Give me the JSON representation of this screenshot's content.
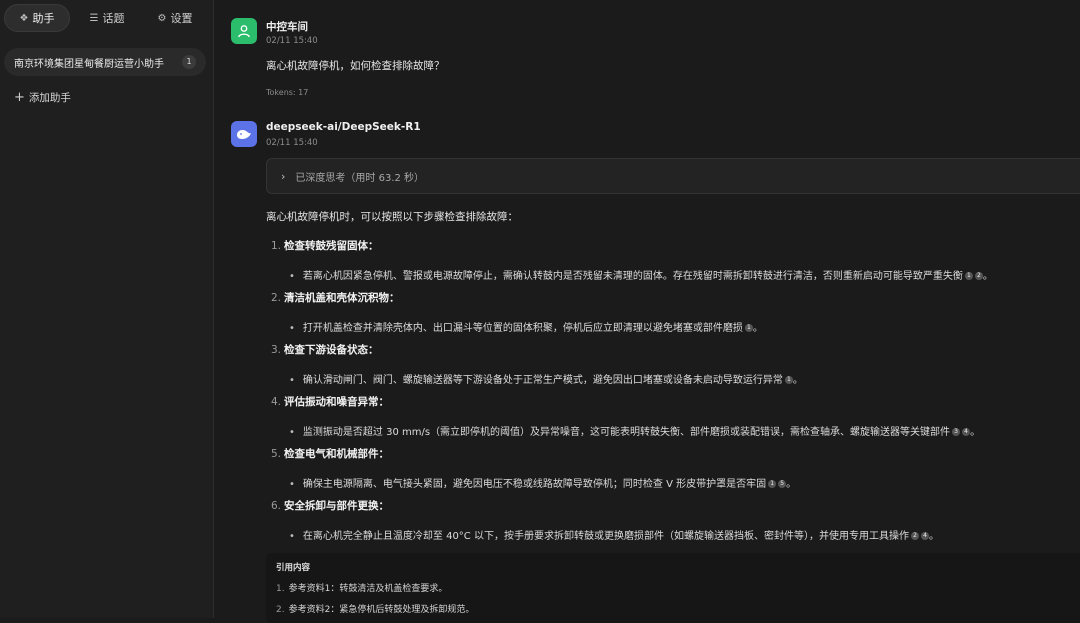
{
  "sidebar": {
    "tabs": [
      {
        "icon": "sparkle-icon",
        "glyph": "❖",
        "label": "助手"
      },
      {
        "icon": "list-icon",
        "glyph": "☰",
        "label": "话题"
      },
      {
        "icon": "gear-icon",
        "glyph": "⚙",
        "label": "设置"
      }
    ],
    "assistant": {
      "name": "南京环境集团星甸餐厨运营小助手",
      "count": "1"
    },
    "add_label": "添加助手"
  },
  "user_message": {
    "author": "中控车间",
    "time": "02/11 15:40",
    "text": "离心机故障停机，如何检查排除故障？",
    "tokens": "Tokens: 17"
  },
  "bot_message": {
    "author": "deepseek-ai/DeepSeek-R1",
    "time": "02/11 15:40",
    "thinking_label": "已深度思考（用时 63.2 秒）",
    "intro": "离心机故障停机时，可以按照以下步骤检查排除故障：",
    "steps": [
      {
        "num": "1.",
        "title": "检查转鼓残留固体：",
        "body": "若离心机因紧急停机、警报或电源故障停止，需确认转鼓内是否残留未清理的固体。存在残留时需拆卸转鼓进行清洁，否则重新启动可能导致严重失衡",
        "cites": [
          "1",
          "2"
        ]
      },
      {
        "num": "2.",
        "title": "清洁机盖和壳体沉积物：",
        "body": "打开机盖检查并清除壳体内、出口漏斗等位置的固体积聚，停机后应立即清理以避免堵塞或部件磨损",
        "cites": [
          "1"
        ]
      },
      {
        "num": "3.",
        "title": "检查下游设备状态：",
        "body": "确认滑动闸门、阀门、螺旋输送器等下游设备处于正常生产模式，避免因出口堵塞或设备未启动导致运行异常",
        "cites": [
          "1"
        ]
      },
      {
        "num": "4.",
        "title": "评估振动和噪音异常：",
        "body": "监测振动是否超过 30 mm/s（需立即停机的阈值）及异常噪音，这可能表明转鼓失衡、部件磨损或装配错误，需检查轴承、螺旋输送器等关键部件",
        "cites": [
          "3",
          "4"
        ]
      },
      {
        "num": "5.",
        "title": "检查电气和机械部件：",
        "body": "确保主电源隔离、电气接头紧固，避免因电压不稳或线路故障导致停机；同时检查 V 形皮带护罩是否牢固",
        "cites": [
          "1",
          "5"
        ]
      },
      {
        "num": "6.",
        "title": "安全拆卸与部件更换：",
        "body": "在离心机完全静止且温度冷却至 40°C 以下，按手册要求拆卸转鼓或更换磨损部件（如螺旋输送器挡板、密封件等），并使用专用工具操作",
        "cites": [
          "2",
          "4"
        ]
      }
    ],
    "references": {
      "title": "引用内容",
      "items": [
        {
          "num": "1.",
          "text": "参考资料1：转鼓清洁及机盖检查要求。"
        },
        {
          "num": "2.",
          "text": "参考资料2：紧急停机后转鼓处理及拆卸规范。"
        }
      ]
    }
  }
}
